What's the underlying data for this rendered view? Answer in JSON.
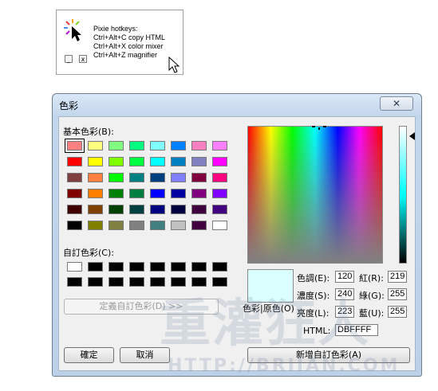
{
  "pixie": {
    "lines": [
      "Pixie hotkeys:",
      "Ctrl+Alt+C copy HTML",
      "Ctrl+Alt+X color mixer",
      "Ctrl+Alt+Z magnifier"
    ],
    "minimize_label": "_",
    "close_label": "x"
  },
  "dialog": {
    "title": "色彩",
    "close_glyph": "✕",
    "basic_colors_label": "基本色彩(B):",
    "custom_colors_label": "自訂色彩(C):",
    "define_button": "定義自訂色彩(D) >>",
    "ok_button": "確定",
    "cancel_button": "取消",
    "add_custom_button": "新增自訂色彩(A)",
    "preview_label": "色彩|原色(O)",
    "fields": {
      "hue": {
        "label": "色調(E):",
        "value": "120"
      },
      "sat": {
        "label": "濃度(S):",
        "value": "240"
      },
      "lum": {
        "label": "亮度(L):",
        "value": "223"
      },
      "red": {
        "label": "紅(R):",
        "value": "219"
      },
      "green": {
        "label": "綠(G):",
        "value": "255"
      },
      "blue": {
        "label": "藍(U):",
        "value": "255"
      },
      "html": {
        "label": "HTML:",
        "value": "DBFFFF"
      }
    },
    "preview_color": "#DBFFFF",
    "basic_colors": [
      [
        "#FF8080",
        "#FFFF80",
        "#80FF80",
        "#00FF80",
        "#80FFFF",
        "#0080FF",
        "#FF80C0",
        "#FF80FF"
      ],
      [
        "#FF0000",
        "#FFFF00",
        "#80FF00",
        "#00FF40",
        "#00FFFF",
        "#0080C0",
        "#8080C0",
        "#FF00FF"
      ],
      [
        "#804040",
        "#FF8040",
        "#00FF00",
        "#008080",
        "#004080",
        "#8080FF",
        "#800040",
        "#FF0080"
      ],
      [
        "#800000",
        "#FF8000",
        "#008000",
        "#008040",
        "#0000FF",
        "#0000A0",
        "#800080",
        "#8000FF"
      ],
      [
        "#400000",
        "#804000",
        "#004000",
        "#004040",
        "#000080",
        "#000040",
        "#400040",
        "#400080"
      ],
      [
        "#000000",
        "#808000",
        "#808040",
        "#808080",
        "#408080",
        "#C0C0C0",
        "#400040",
        "#FFFFFF"
      ]
    ],
    "custom_colors": [
      [
        "#FFFFFF",
        "#000000",
        "#000000",
        "#000000",
        "#000000",
        "#000000",
        "#000000",
        "#000000"
      ],
      [
        "#000000",
        "#000000",
        "#000000",
        "#000000",
        "#000000",
        "#000000",
        "#000000",
        "#000000"
      ]
    ],
    "selected_basic": [
      0,
      0
    ]
  },
  "watermark": {
    "line1": "重灌狂人",
    "line2": "HTTP://BRIIAN.COM"
  }
}
